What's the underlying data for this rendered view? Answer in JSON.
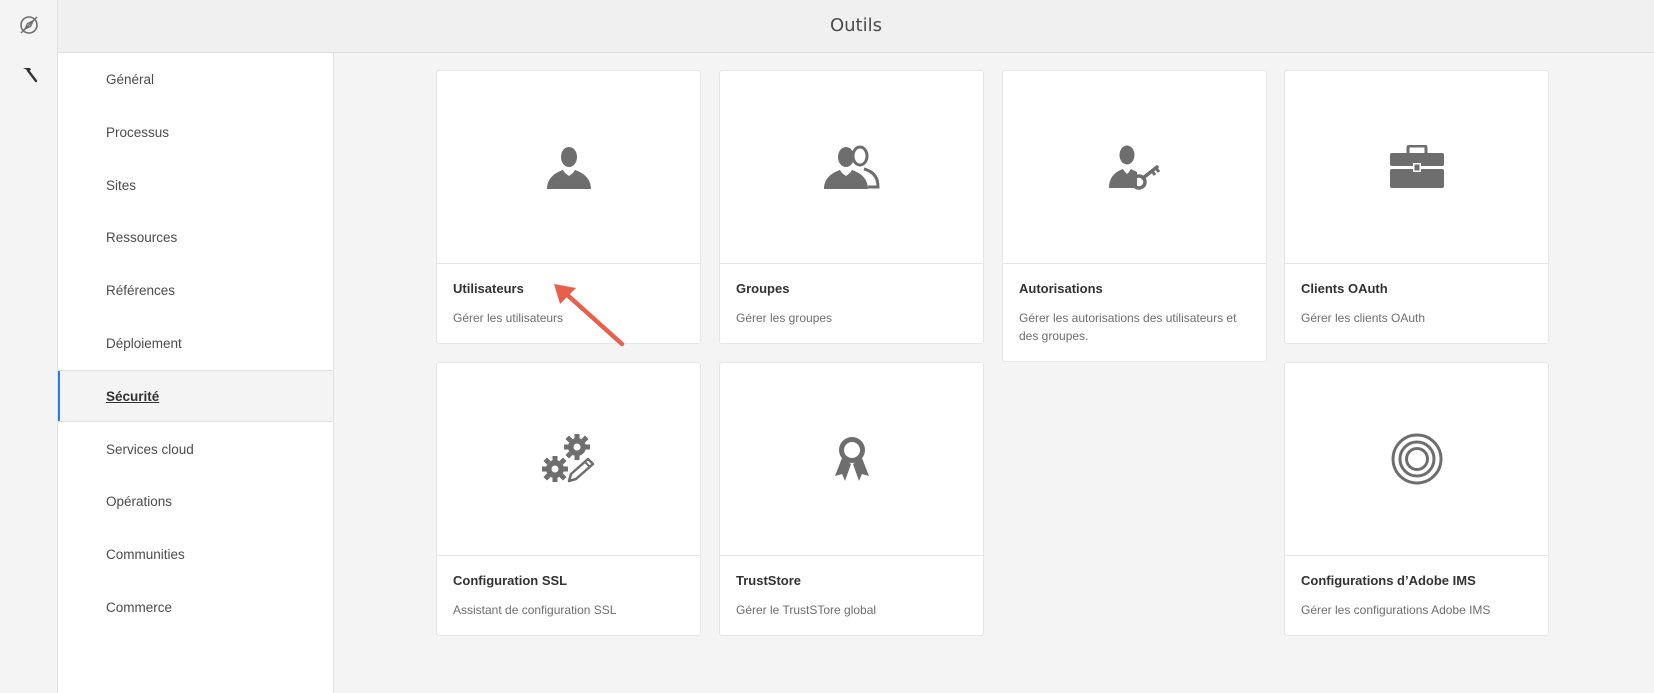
{
  "header": {
    "title": "Outils"
  },
  "rail": {
    "items": [
      {
        "icon": "navigation-compass-icon"
      },
      {
        "icon": "hammer-icon"
      }
    ]
  },
  "sidenav": {
    "items": [
      {
        "label": "Général"
      },
      {
        "label": "Processus"
      },
      {
        "label": "Sites"
      },
      {
        "label": "Ressources"
      },
      {
        "label": "Références"
      },
      {
        "label": "Déploiement"
      },
      {
        "label": "Sécurité",
        "active": true
      },
      {
        "label": "Services cloud"
      },
      {
        "label": "Opérations"
      },
      {
        "label": "Communities"
      },
      {
        "label": "Commerce"
      }
    ]
  },
  "cards": [
    {
      "title": "Utilisateurs",
      "description": "Gérer les utilisateurs",
      "icon": "user-icon"
    },
    {
      "title": "Groupes",
      "description": "Gérer les groupes",
      "icon": "users-group-icon"
    },
    {
      "title": "Autorisations",
      "description": "Gérer les autorisations des utilisateurs et des groupes.",
      "icon": "user-key-icon"
    },
    {
      "title": "Clients OAuth",
      "description": "Gérer les clients OAuth",
      "icon": "briefcase-icon"
    },
    {
      "title": "Configuration SSL",
      "description": "Assistant de configuration SSL",
      "icon": "gears-edit-icon"
    },
    {
      "title": "TrustStore",
      "description": "Gérer le TrustSTore global",
      "icon": "badge-icon"
    },
    {
      "title": "Configurations d’Adobe IMS",
      "description": "Gérer les configurations Adobe IMS",
      "icon": "target-icon"
    }
  ],
  "colors": {
    "accent": "#2680eb",
    "annotation_arrow": "#e8604c",
    "icon": "#6e6e6e"
  }
}
